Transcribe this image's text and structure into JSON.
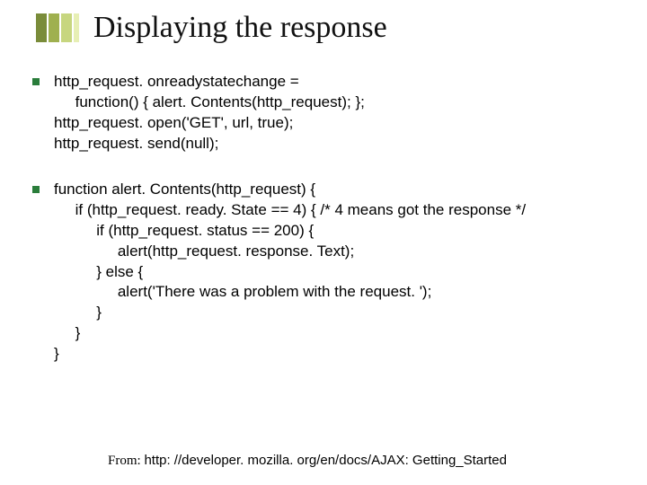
{
  "slide": {
    "title": "Displaying the response",
    "block1": "http_request. onreadystatechange =\n     function() { alert. Contents(http_request); };\nhttp_request. open('GET', url, true);\nhttp_request. send(null);",
    "block2": "function alert. Contents(http_request) {\n     if (http_request. ready. State == 4) { /* 4 means got the response */\n          if (http_request. status == 200) {\n               alert(http_request. response. Text);\n          } else {\n               alert('There was a problem with the request. ');\n          }\n     }\n}",
    "footer_label": "From: ",
    "footer_url": "http: //developer. mozilla. org/en/docs/AJAX: Getting_Started"
  }
}
